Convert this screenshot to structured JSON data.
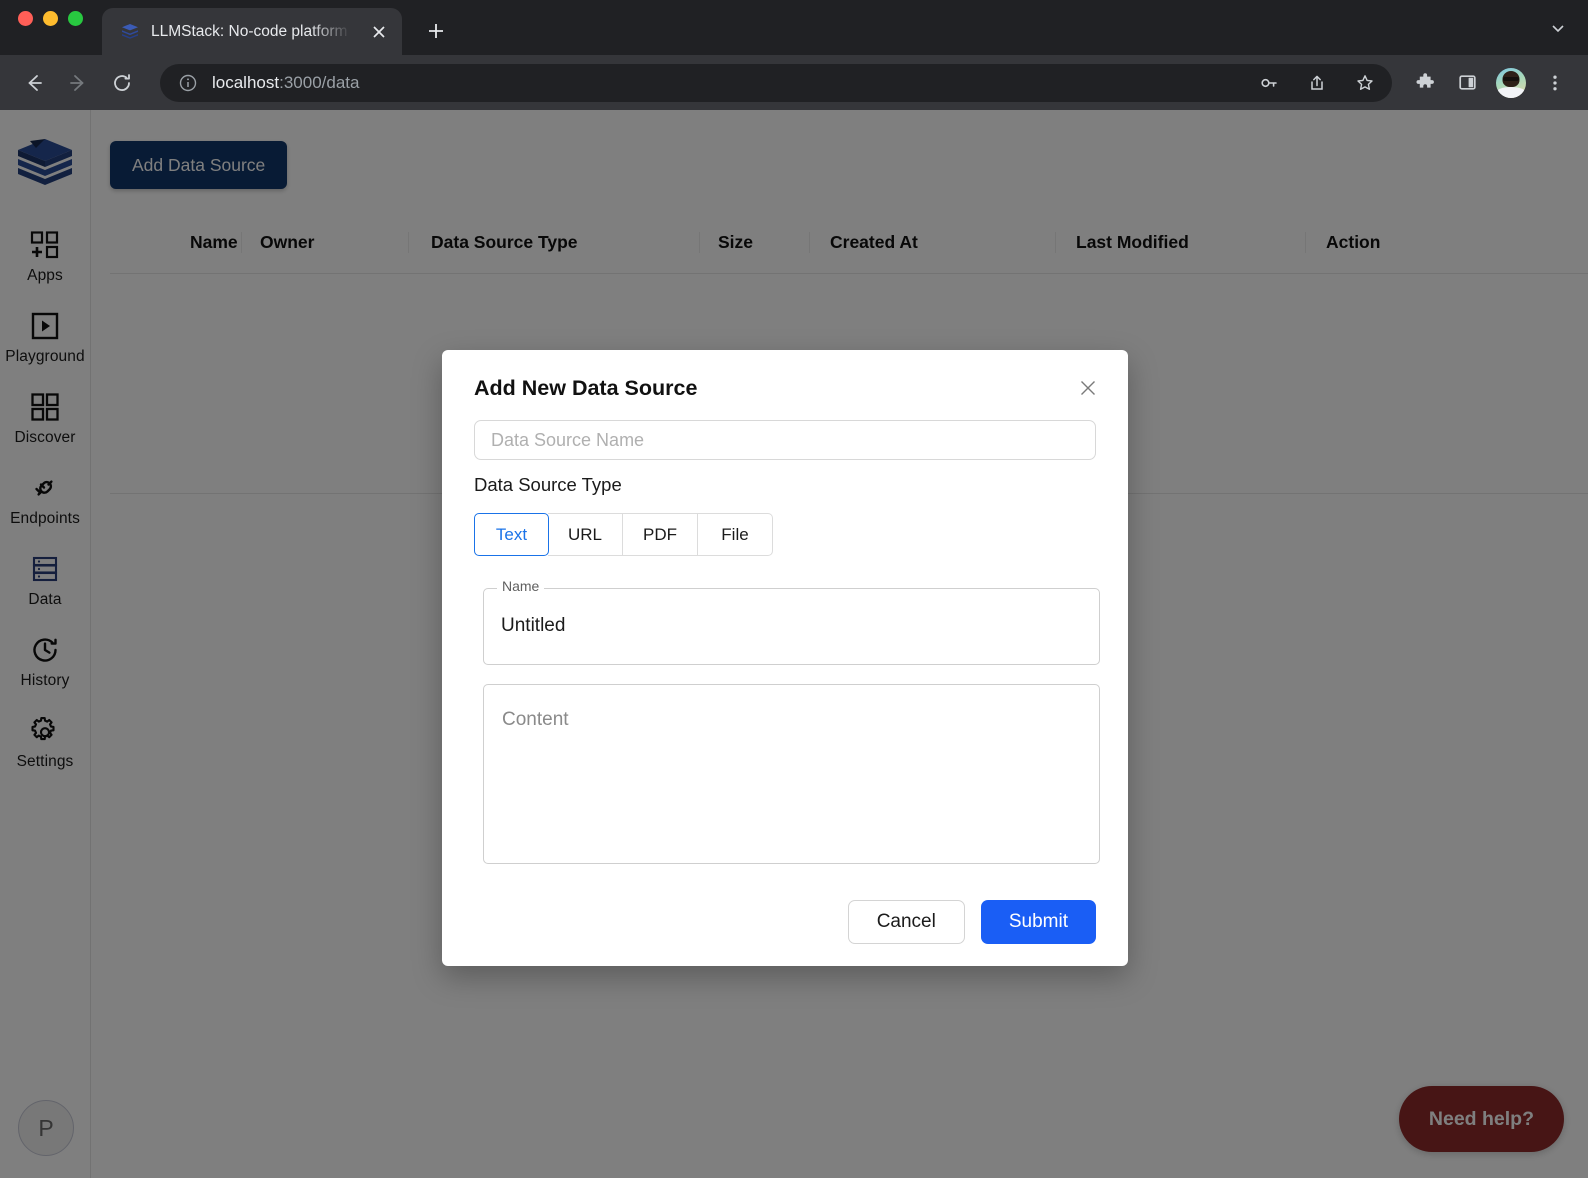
{
  "browser": {
    "tab": {
      "title": "LLMStack: No-code platform to",
      "favicon": "stack-layers-icon",
      "close_icon": "close-icon"
    },
    "new_tab_icon": "plus-icon",
    "nav": {
      "back_icon": "arrow-left-icon",
      "forward_icon": "arrow-right-icon",
      "reload_icon": "reload-icon"
    },
    "omnibox": {
      "info_icon": "info-circle-icon",
      "host": "localhost",
      "path": ":3000/data",
      "key_icon": "key-icon",
      "share_icon": "share-icon",
      "bookmark_icon": "star-icon"
    },
    "actions": {
      "extensions_icon": "puzzle-piece-icon",
      "side_panel_icon": "side-panel-icon",
      "profile_icon": "profile-avatar",
      "menu_icon": "three-dots-vertical-icon"
    },
    "window_controls": {
      "close": "close-window",
      "minimize": "minimize-window",
      "zoom": "zoom-window"
    },
    "tab_list_icon": "chevron-down-icon"
  },
  "sidebar": {
    "logo": "llmstack-logo",
    "items": [
      {
        "label": "Apps",
        "icon": "apps-grid-plus-icon",
        "active": false
      },
      {
        "label": "Playground",
        "icon": "play-square-icon",
        "active": false
      },
      {
        "label": "Discover",
        "icon": "grid-four-icon",
        "active": false
      },
      {
        "label": "Endpoints",
        "icon": "plug-connect-icon",
        "active": false
      },
      {
        "label": "Data",
        "icon": "database-server-icon",
        "active": true
      },
      {
        "label": "History",
        "icon": "clock-history-icon",
        "active": false
      },
      {
        "label": "Settings",
        "icon": "gear-icon",
        "active": false
      }
    ],
    "user_avatar": {
      "initial": "P",
      "name": "user-avatar"
    }
  },
  "main": {
    "add_data_source_label": "Add Data Source",
    "table": {
      "columns": [
        "Name",
        "Owner",
        "Data Source Type",
        "Size",
        "Created At",
        "Last Modified",
        "Action"
      ],
      "rows": []
    },
    "need_help_label": "Need help?"
  },
  "modal": {
    "title": "Add New Data Source",
    "close_icon": "close-icon",
    "name_input": {
      "value": "",
      "placeholder": "Data Source Name"
    },
    "type_section_label": "Data Source Type",
    "type_options": [
      {
        "label": "Text",
        "selected": true
      },
      {
        "label": "URL",
        "selected": false
      },
      {
        "label": "PDF",
        "selected": false
      },
      {
        "label": "File",
        "selected": false
      }
    ],
    "name_field": {
      "legend": "Name",
      "value": "Untitled"
    },
    "content_field": {
      "placeholder": "Content",
      "value": ""
    },
    "cancel_label": "Cancel",
    "submit_label": "Submit"
  },
  "colors": {
    "accent_blue": "#1a73e8",
    "submit_blue": "#1a5ef5",
    "brand_navy": "#11366b",
    "help_red": "#8e2a2a",
    "chrome_dark": "#202124",
    "chrome_toolbar": "#35363a"
  }
}
